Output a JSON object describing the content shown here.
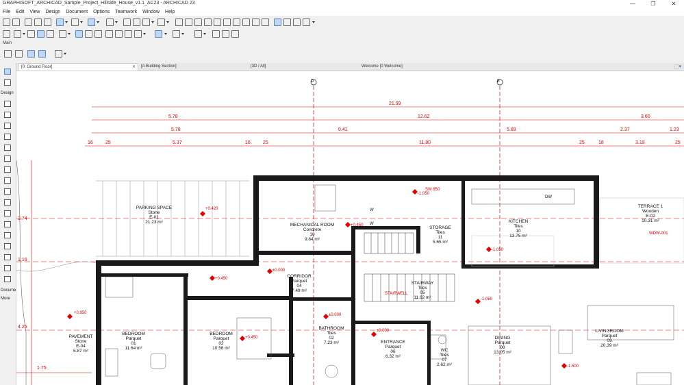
{
  "window": {
    "title": "GRAPHISOFT_ARCHICAD_Sample_Project_Hillside_House_v1.1_AC23 - ARCHICAD 23",
    "controls": [
      "—",
      "❐",
      "✕"
    ]
  },
  "menu": [
    "File",
    "Edit",
    "View",
    "Design",
    "Document",
    "Options",
    "Teamwork",
    "Window",
    "Help"
  ],
  "toolbar": {
    "palette_label": "Main"
  },
  "tabs": [
    {
      "label": "[0. Ground Floor]",
      "active": true
    },
    {
      "label": "[A Building Section]",
      "active": false
    },
    {
      "label": "[3D / All]",
      "active": false
    },
    {
      "label": "Welcome [0 Welcome]",
      "active": false
    }
  ],
  "toolbox": {
    "design_label": "Design",
    "document_label": "Docume",
    "more_label": "More"
  },
  "plan": {
    "grid_markers": [
      "D",
      "E"
    ],
    "dimension_rows": [
      [
        "21.99"
      ],
      [
        "5.78",
        "12.62",
        "3.60"
      ],
      [
        "5.78",
        "0.41",
        "5.89",
        "2.37",
        "1.23"
      ],
      [
        "16",
        "25",
        "5.37",
        "16",
        "25",
        "11.80",
        "25",
        "16",
        "3.19",
        "25"
      ]
    ],
    "rooms": [
      {
        "name": "PARKING SPACE",
        "finish": "Stone",
        "code": "E-01",
        "area": "21.23 m²"
      },
      {
        "name": "MECHANICAL ROOM",
        "finish": "Concrete",
        "code": "10",
        "area": "9.84 m²"
      },
      {
        "name": "STORAGE",
        "finish": "Tiles",
        "code": "11",
        "area": "5.65 m²"
      },
      {
        "name": "KITCHEN",
        "finish": "Tiles",
        "code": "10",
        "area": "13.75 m²"
      },
      {
        "name": "TERRACE 1",
        "finish": "Wooden",
        "code": "E-02",
        "area": "10.31 m²"
      },
      {
        "name": "CORRIDOR",
        "finish": "Parquet",
        "code": "04",
        "area": "7.49 m²"
      },
      {
        "name": "STAIRWAY",
        "finish": "Tiles",
        "code": "05",
        "area": "11.62 m²"
      },
      {
        "name": "BEDROOM",
        "finish": "Parquet",
        "code": "01",
        "area": "11.64 m²"
      },
      {
        "name": "BEDROOM",
        "finish": "Parquet",
        "code": "02",
        "area": "10.56 m²"
      },
      {
        "name": "BATHROOM",
        "finish": "Tiles",
        "code": "02",
        "area": "7.23 m²"
      },
      {
        "name": "ENTRANCE",
        "finish": "Parquet",
        "code": "06",
        "area": "6.32 m²"
      },
      {
        "name": "WC",
        "finish": "Tiles",
        "code": "07",
        "area": "2.62 m²"
      },
      {
        "name": "DINING",
        "finish": "Parquet",
        "code": "08",
        "area": "13.05 m²"
      },
      {
        "name": "LIVINGROOM",
        "finish": "Parquet",
        "code": "09",
        "area": "20.39 m²"
      },
      {
        "name": "PAVEMENT",
        "finish": "Stone",
        "code": "E-04",
        "area": "5.87 m²"
      }
    ],
    "level_tags": [
      "+0.420",
      "+0.450",
      "-1.050",
      "+0.450",
      "±0.000",
      "+0.450",
      "±0.000",
      "-1.050",
      "+0.950",
      "±0.000",
      "+0.450",
      "-1.500",
      "-1.050"
    ],
    "side_dims": [
      "2.74",
      "1.75",
      "4.25",
      "1.16"
    ],
    "misc_labels": [
      "DW",
      "W",
      "W",
      "SW 850",
      "WDW-001",
      "STAIRWELL"
    ]
  },
  "colors": {
    "annotation": "#e00000",
    "wall": "#1a1a1a",
    "selection": "#bfd7f2"
  }
}
